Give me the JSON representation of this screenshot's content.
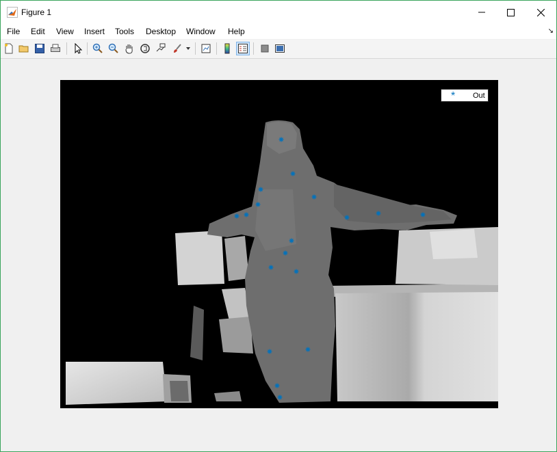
{
  "window": {
    "title": "Figure 1"
  },
  "menu": {
    "items": [
      "File",
      "Edit",
      "View",
      "Insert",
      "Tools",
      "Desktop",
      "Window",
      "Help"
    ]
  },
  "toolbar": {
    "buttons": [
      {
        "name": "new-figure-icon"
      },
      {
        "name": "open-file-icon"
      },
      {
        "name": "save-icon"
      },
      {
        "name": "print-icon"
      },
      {
        "name": "edit-plot-icon"
      },
      {
        "name": "zoom-in-icon"
      },
      {
        "name": "zoom-out-icon"
      },
      {
        "name": "pan-icon"
      },
      {
        "name": "rotate-3d-icon"
      },
      {
        "name": "data-cursor-icon"
      },
      {
        "name": "brush-icon"
      },
      {
        "name": "link-plot-icon"
      },
      {
        "name": "colorbar-icon"
      },
      {
        "name": "legend-icon",
        "active": true
      },
      {
        "name": "hide-plot-tools-icon"
      },
      {
        "name": "show-plot-tools-icon"
      }
    ]
  },
  "legend": {
    "marker": "*",
    "label": "Out"
  },
  "colors": {
    "marker": "#0072bd",
    "border": "#3aa55c"
  }
}
